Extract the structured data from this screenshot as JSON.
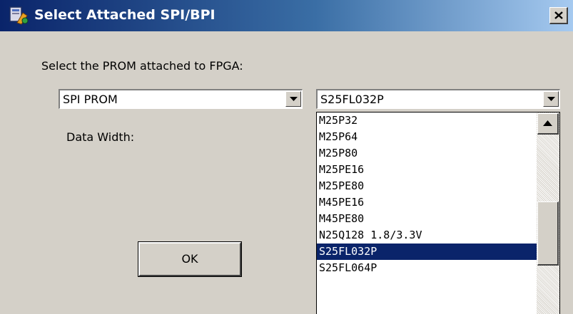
{
  "window": {
    "title": "Select Attached SPI/BPI",
    "close_label": "×"
  },
  "prompt_label": "Select the PROM attached to FPGA:",
  "data_width_label": "Data Width:",
  "prom_type": {
    "value": "SPI PROM"
  },
  "prom_part": {
    "value": "S25FL032P",
    "options": [
      "M25P32",
      "M25P64",
      "M25P80",
      "M25PE16",
      "M25PE80",
      "M45PE16",
      "M45PE80",
      "N25Q128 1.8/3.3V",
      "S25FL032P",
      "S25FL064P"
    ],
    "selected_index": 8
  },
  "ok_label": "OK",
  "colors": {
    "title_bar_start": "#0a246a",
    "title_bar_end": "#a6caf0",
    "dialog_bg": "#d4d0c8",
    "selection_bg": "#0a246a"
  }
}
